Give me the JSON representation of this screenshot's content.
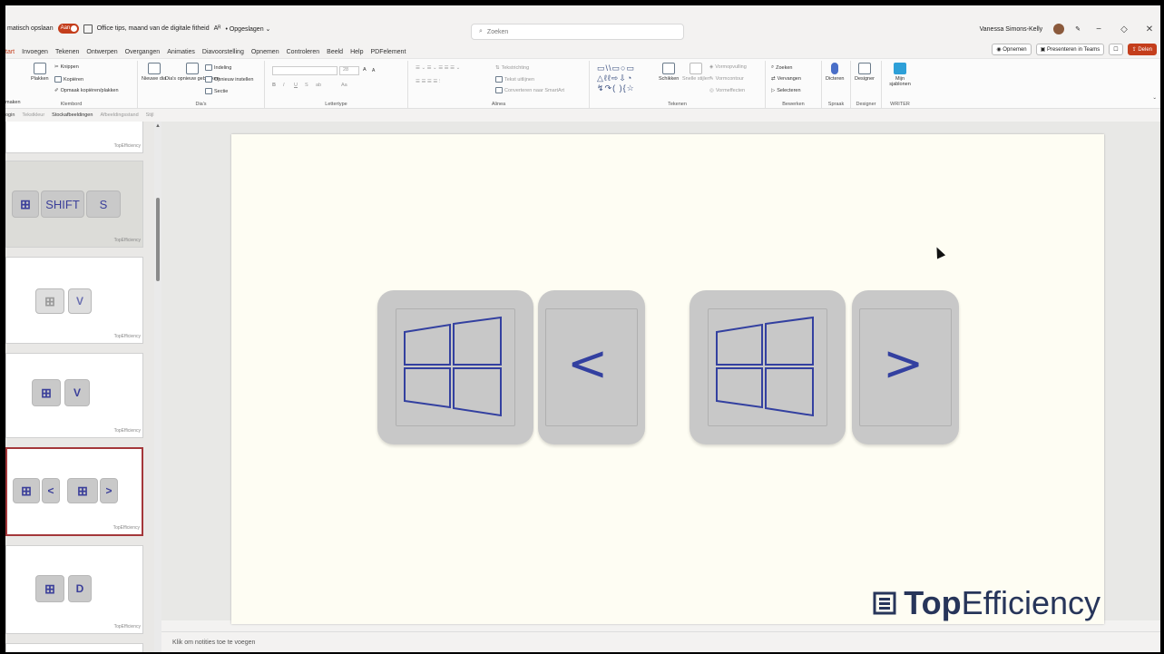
{
  "titlebar": {
    "autosave_label": "matisch opslaan",
    "autosave_state": "Aan",
    "doc_title": "Office tips, maand van de digitale fitheid",
    "sensitivity": "Aᴿ",
    "saved_status": "• Opgeslagen ⌄",
    "search_placeholder": "Zoeken",
    "user_name": "Vanessa Simons-Kelly",
    "pen_icon": "✎",
    "minimize": "−",
    "restore": "◇",
    "close": "✕"
  },
  "tabs": [
    "tart",
    "Invoegen",
    "Tekenen",
    "Ontwerpen",
    "Overgangen",
    "Animaties",
    "Diavoorstelling",
    "Opnemen",
    "Controleren",
    "Beeld",
    "Help",
    "PDFelement"
  ],
  "tab_right": {
    "record": "◉ Opnemen",
    "present_teams": "▣ Presenteren in Teams",
    "comment": "☐",
    "share": "Delen"
  },
  "ribbon": {
    "clipboard": {
      "paste": "Plakken",
      "cut": "Knippen",
      "copy": "Kopiëren",
      "format_painter": "Opmaak kopiëren/plakken",
      "label": "Klembord",
      "undo_label": "maken"
    },
    "slides": {
      "new_slide": "Nieuwe dia",
      "reuse": "Dia's opnieuw gebruiken",
      "layout": "Indeling",
      "reset": "Opnieuw instellen",
      "section": "Sectie",
      "label": "Dia's"
    },
    "font": {
      "label": "Lettertype",
      "size": "28",
      "grow": "A",
      "shrink": "A",
      "bold": "B",
      "italic": "I",
      "underline": "U",
      "strike": "S",
      "spacing": "ab",
      "case": "Aa"
    },
    "paragraph": {
      "label": "Alinea",
      "text_dir": "Tekstrichting",
      "align_text": "Tekst uitlijnen",
      "smartart": "Converteren naar SmartArt"
    },
    "drawing": {
      "label": "Tekenen",
      "arrange": "Schikken",
      "quick_styles": "Snelle stijlen",
      "fill": "Vormopvulling",
      "outline": "Vormcontour",
      "effects": "Vormeffecten"
    },
    "editing": {
      "label": "Bewerken",
      "find": "Zoeken",
      "replace": "Vervangen",
      "select": "Selecteren"
    },
    "voice": {
      "dictate": "Dicteren",
      "label": "Spraak"
    },
    "designer": {
      "designer": "Designer",
      "label": "Designer"
    },
    "writer": {
      "templates": "Mijn sjablonen",
      "label": "WRITER"
    }
  },
  "subbar": [
    "ogin",
    "Tekstkleur",
    "Stockafbeeldingen",
    "Afbeeldingsstand",
    "Stijl"
  ],
  "thumbnails": [
    {
      "keys": [],
      "brand": "TopEfficiency"
    },
    {
      "keys": [
        "⊞",
        "SHIFT",
        "S"
      ],
      "brand": "TopEfficiency"
    },
    {
      "keys": [
        "⊞",
        "V"
      ],
      "brand": "TopEfficiency"
    },
    {
      "keys": [
        "⊞",
        "V"
      ],
      "brand": "TopEfficiency"
    },
    {
      "keys": [
        "⊞",
        "<",
        "⊞",
        ">"
      ],
      "brand": "TopEfficiency"
    },
    {
      "keys": [
        "⊞",
        "D"
      ],
      "brand": "TopEfficiency"
    }
  ],
  "slide": {
    "key_left_symbol": "<",
    "key_right_symbol": ">",
    "brand_bold": "Top",
    "brand_light": "Efficiency",
    "accent": "#3340a0"
  },
  "notes": {
    "placeholder": "Klik om notities toe te voegen"
  }
}
